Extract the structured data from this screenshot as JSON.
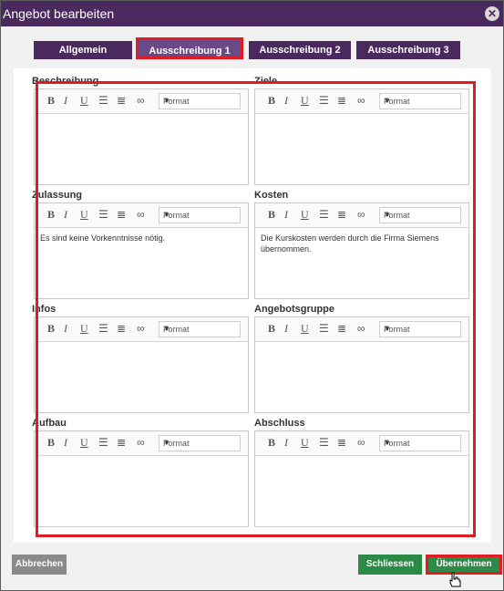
{
  "dialog": {
    "title": "Angebot bearbeiten",
    "close_symbol": "✕"
  },
  "tabs": [
    {
      "label": "Allgemein"
    },
    {
      "label": "Ausschreibung 1",
      "active": true
    },
    {
      "label": "Ausschreibung 2"
    },
    {
      "label": "Ausschreibung 3"
    }
  ],
  "editor_toolbar": {
    "bold": "B",
    "italic": "I",
    "underline": "U",
    "bulleted_list_icon": "bulleted-list-icon",
    "numbered_list_icon": "numbered-list-icon",
    "link_icon": "link-icon",
    "format_placeholder": "Format"
  },
  "fields": [
    {
      "label": "Beschreibung",
      "value": ""
    },
    {
      "label": "Ziele",
      "value": ""
    },
    {
      "label": "Zulassung",
      "value": "Es sind keine Vorkenntnisse nötig."
    },
    {
      "label": "Kosten",
      "value": "Die Kurskosten werden durch die Firma Siemens übernommen."
    },
    {
      "label": "Infos",
      "value": ""
    },
    {
      "label": "Angebotsgruppe",
      "value": ""
    },
    {
      "label": "Aufbau",
      "value": ""
    },
    {
      "label": "Abschluss",
      "value": ""
    }
  ],
  "buttons": {
    "cancel": "Abbrechen",
    "close": "Schliessen",
    "apply": "Übernehmen"
  },
  "colors": {
    "titlebar": "#4a2a5e",
    "tab": "#4a2a5e",
    "highlight": "#e11b22",
    "primary_button": "#2b8a45",
    "cancel_button": "#8a8a8a"
  }
}
